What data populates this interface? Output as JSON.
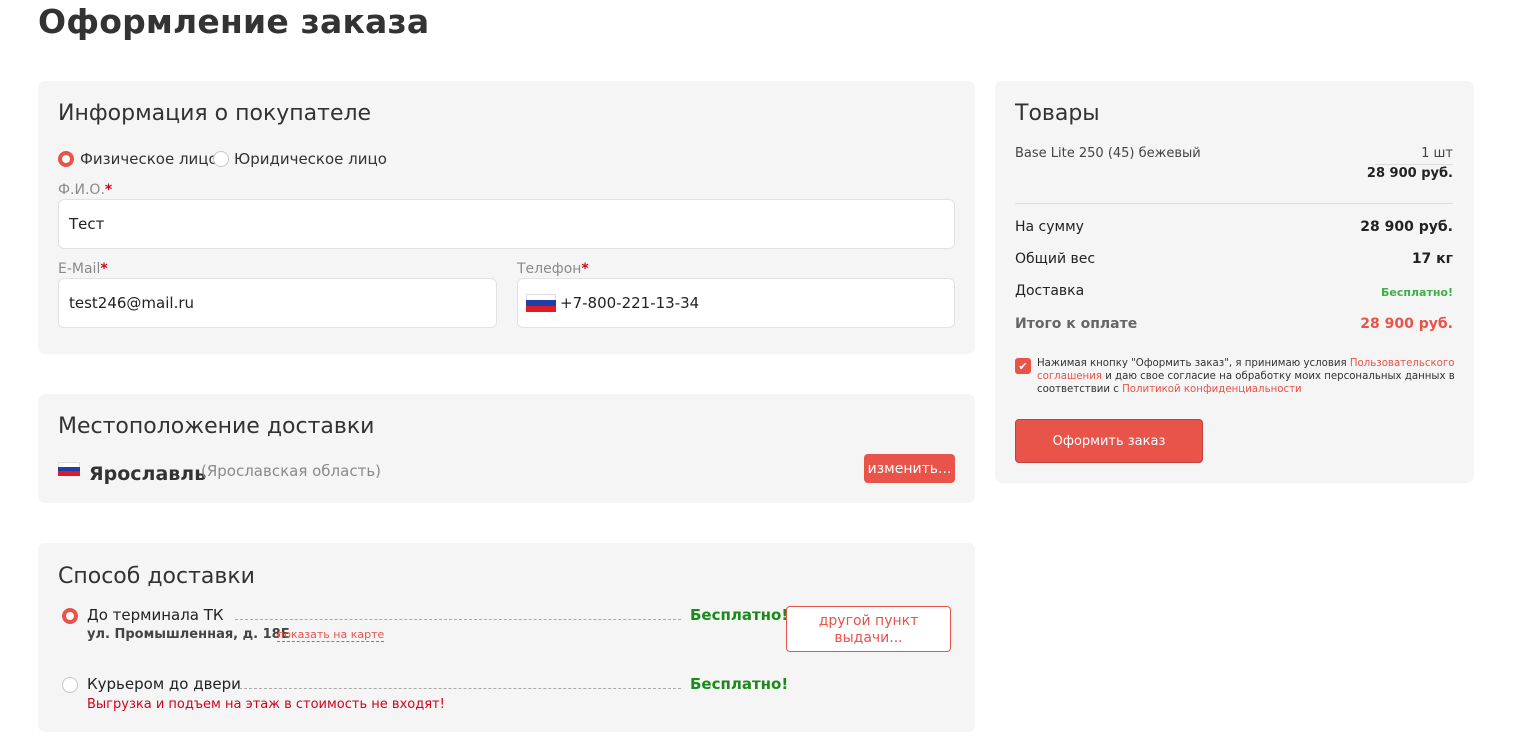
{
  "page_title": "Оформление заказа",
  "buyer": {
    "title": "Информация о покупателе",
    "type_options": [
      {
        "label": "Физическое лицо",
        "selected": true
      },
      {
        "label": "Юридическое лицо",
        "selected": false
      }
    ],
    "fio_label": "Ф.И.О.",
    "fio_value": "Тест",
    "email_label": "E-Mail",
    "email_value": "test246@mail.ru",
    "phone_label": "Телефон",
    "phone_value": "+7-800-221-13-34",
    "required_mark": "*"
  },
  "location": {
    "title": "Местоположение доставки",
    "city": "Ярославль",
    "region": "(Ярославская область)",
    "change_button": "изменить..."
  },
  "shipping": {
    "title": "Способ доставки",
    "methods": [
      {
        "name": "До терминала ТК",
        "price": "Бесплатно!",
        "address": "ул. Промышленная, д. 18Е",
        "map_link": "показать на карте",
        "selected": true
      },
      {
        "name": "Курьером до двери",
        "price": "Бесплатно!",
        "note": "Выгрузка и подъем на этаж в стоимость не входят!",
        "selected": false
      }
    ],
    "other_point_button": "другой пункт выдачи..."
  },
  "goods": {
    "title": "Товары",
    "items": [
      {
        "name": "Base Lite 250 (45) бежевый",
        "qty": "1 шт",
        "price": "28 900 руб."
      }
    ],
    "summary": {
      "sum_label": "На сумму",
      "sum_value": "28 900 руб.",
      "weight_label": "Общий вес",
      "weight_value": "17 кг",
      "delivery_label": "Доставка",
      "delivery_value": "Бесплатно!",
      "total_label": "Итого к оплате",
      "total_value": "28 900 руб."
    },
    "consent": {
      "checked": true,
      "text_1": "Нажимая кнопку \"Оформить заказ\", я принимаю условия ",
      "link_1": "Пользовательского соглашения",
      "text_2": " и даю свое согласие на обработку моих персональных данных в соответствии с ",
      "link_2": "Политикой конфиденциальности"
    },
    "order_button": "Оформить заказ"
  },
  "colors": {
    "accent": "#e8534a",
    "free_green": "#1a8a1a",
    "card_bg": "#f5f5f5",
    "warning_red": "#d0021b"
  },
  "icons": {
    "flag": "russia-flag-icon",
    "check": "checkmark-icon"
  }
}
